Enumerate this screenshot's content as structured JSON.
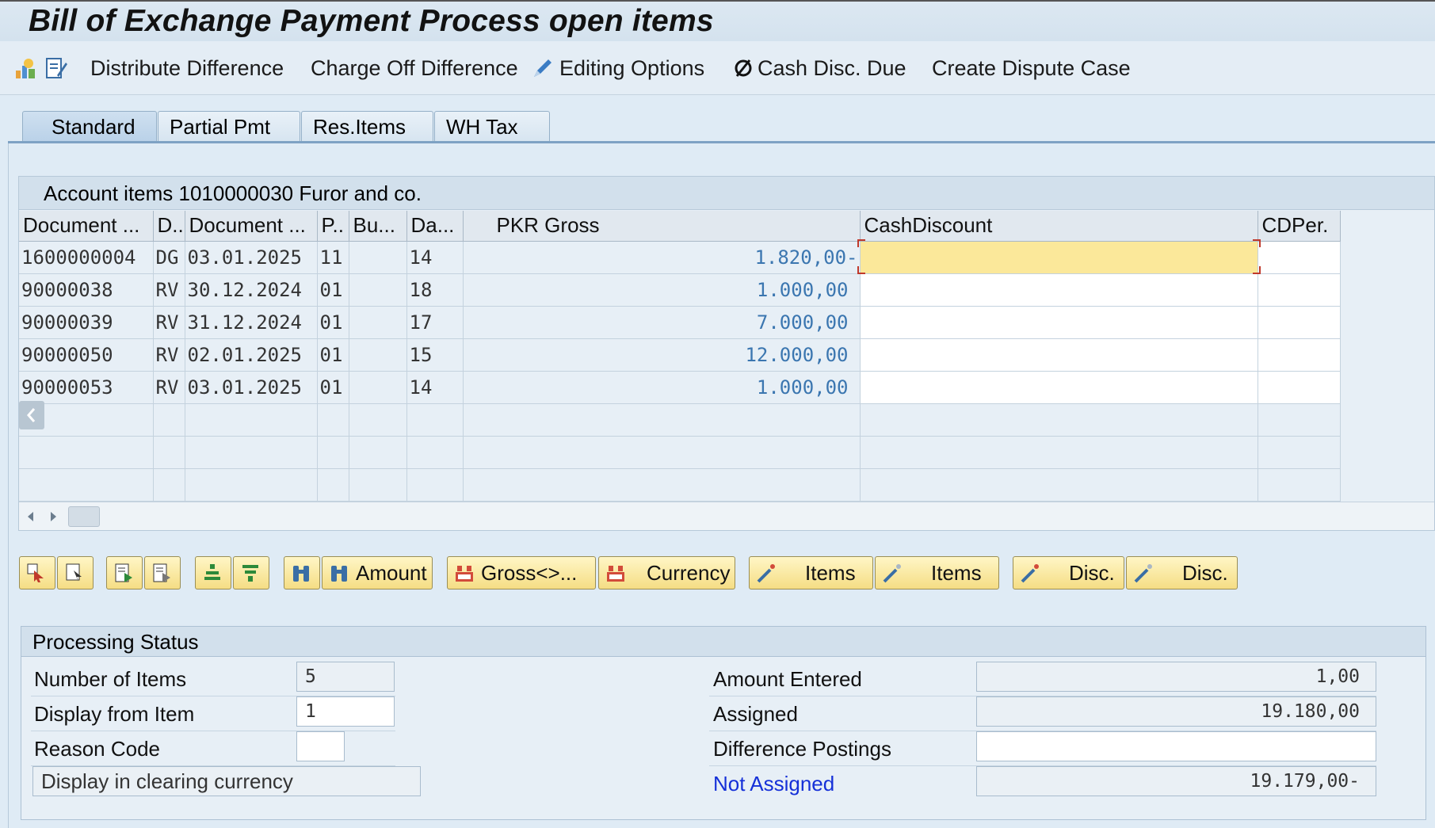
{
  "window": {
    "title": "Bill of Exchange Payment Process open items"
  },
  "toolbar": {
    "distribute": "Distribute Difference",
    "charge_off": "Charge Off Difference",
    "editing": "Editing Options",
    "cash_disc": "Cash Disc. Due",
    "dispute": "Create Dispute Case"
  },
  "tabs": [
    "Standard",
    "Partial Pmt",
    "Res.Items",
    "WH Tax"
  ],
  "grid": {
    "title": "Account items 1010000030 Furor and co.",
    "columns": [
      "Document ...",
      "D..",
      "Document ...",
      "P..",
      "Bu...",
      "Da...",
      "PKR Gross",
      "CashDiscount",
      "CDPer."
    ],
    "rows": [
      [
        "1600000004",
        "DG",
        "03.01.2025",
        "11",
        "",
        "14",
        "1.820,00-",
        "",
        ""
      ],
      [
        "90000038",
        "RV",
        "30.12.2024",
        "01",
        "",
        "18",
        "1.000,00",
        "",
        ""
      ],
      [
        "90000039",
        "RV",
        "31.12.2024",
        "01",
        "",
        "17",
        "7.000,00",
        "",
        ""
      ],
      [
        "90000050",
        "RV",
        "02.01.2025",
        "01",
        "",
        "15",
        "12.000,00",
        "",
        ""
      ],
      [
        "90000053",
        "RV",
        "03.01.2025",
        "01",
        "",
        "14",
        "1.000,00",
        "",
        ""
      ]
    ]
  },
  "buttons": {
    "amount": "Amount",
    "gross": "Gross<>...",
    "currency": "Currency",
    "items1": "Items",
    "items2": "Items",
    "disc1": "Disc.",
    "disc2": "Disc."
  },
  "status": {
    "title": "Processing Status",
    "num_items_label": "Number of Items",
    "num_items": "5",
    "display_from_label": "Display from Item",
    "display_from": "1",
    "reason_code_label": "Reason Code",
    "reason_code": "",
    "clearing_currency": "Display in clearing currency",
    "amount_entered_label": "Amount Entered",
    "amount_entered": "1,00",
    "assigned_label": "Assigned",
    "assigned": "19.180,00",
    "diff_postings_label": "Difference Postings",
    "diff_postings": "",
    "not_assigned_label": "Not Assigned",
    "not_assigned": "19.179,00-"
  },
  "colors": {
    "selected_cell": "#fbe89a",
    "amount_text": "#3b76b0",
    "link_blue": "#1530d8"
  }
}
